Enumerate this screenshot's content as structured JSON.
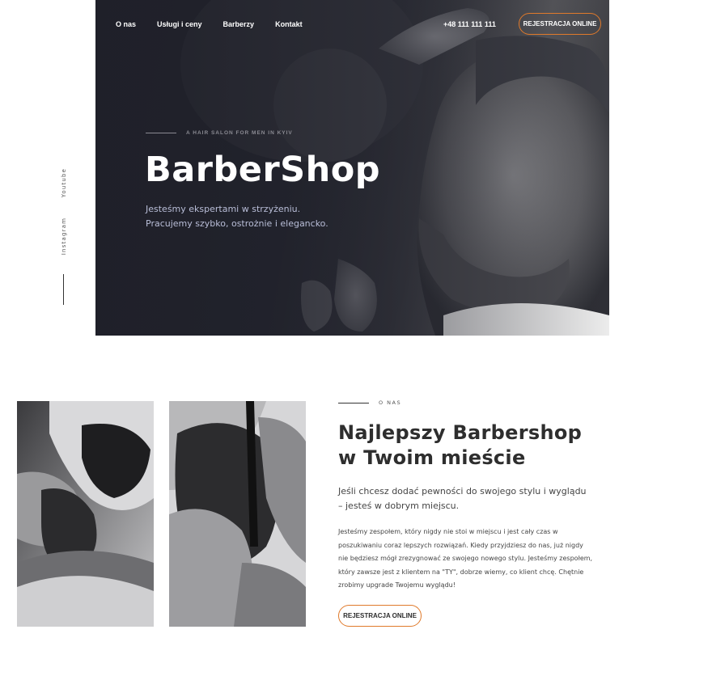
{
  "social": {
    "youtube": "Youtube",
    "instagram": "Instagram"
  },
  "nav": {
    "items": [
      "O nas",
      "Usługi i ceny",
      "Barberzy",
      "Kontakt"
    ],
    "phone": "+48 111 111 111",
    "cta": "REJESTRACJA ONLINE"
  },
  "hero": {
    "eyebrow": "A HAIR SALON FOR MEN IN KYIV",
    "title": "BarberShop",
    "subtitle_line1": "Jesteśmy ekspertami w strzyżeniu.",
    "subtitle_line2": "Pracujemy szybko, ostrożnie i elegancko."
  },
  "about": {
    "eyebrow": "O NAS",
    "title_line1": "Najlepszy Barbershop",
    "title_line2": "w Twoim mieście",
    "lead": "Jeśli chcesz dodać pewności do swojego stylu i wyglądu – jesteś w dobrym miejscu.",
    "body": "Jesteśmy zespołem, który nigdy nie stoi w miejscu i jest cały czas w poszukiwaniu coraz lepszych rozwiązań. Kiedy przyjdziesz do nas, już nigdy nie będziesz mógł zrezygnować ze swojego nowego stylu. Jesteśmy zespołem, który zawsze jest z klientem na \"TY\", dobrze wiemy, co klient chcę. Chętnie zrobimy upgrade Twojemu wyglądu!",
    "cta": "REJESTRACJA ONLINE"
  },
  "colors": {
    "accent": "#e07a2b",
    "hero_bg": "#24252e",
    "heading": "#2e2e2e"
  }
}
